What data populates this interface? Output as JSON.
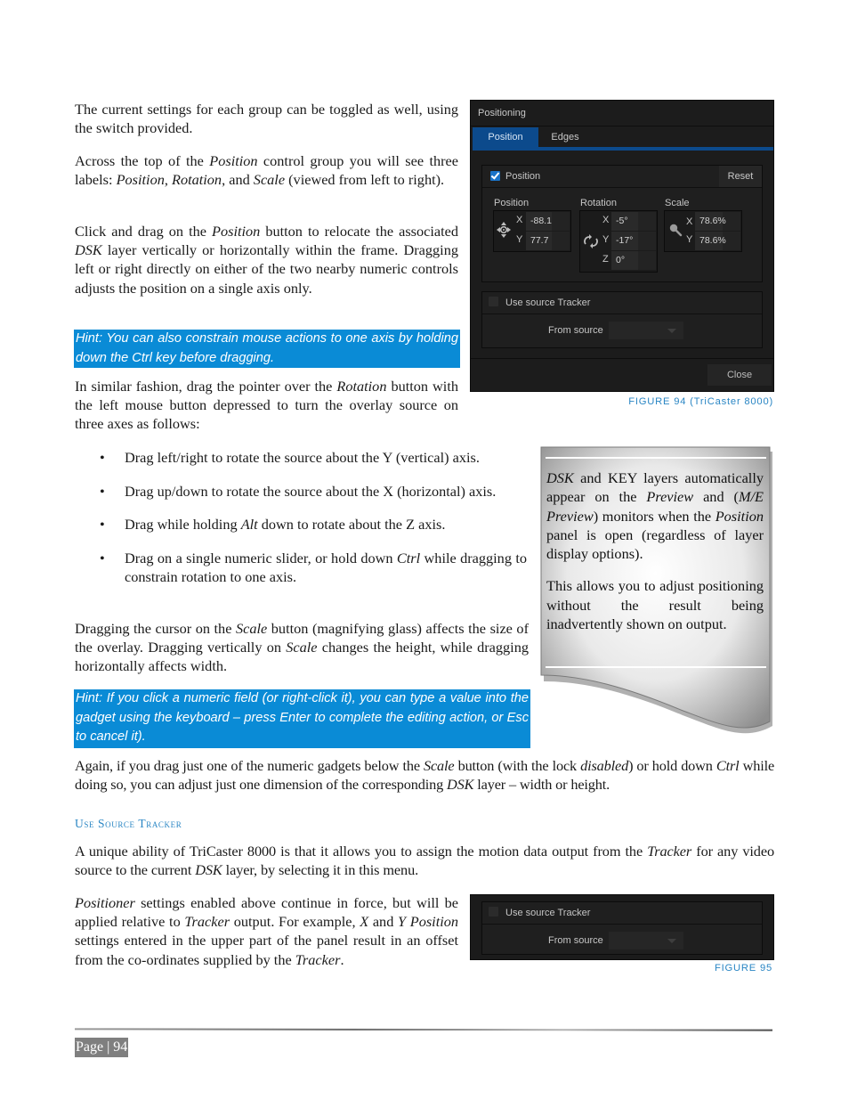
{
  "page": {
    "number_label": "Page | 94"
  },
  "paragraphs": {
    "p1": "The current settings for each group can be toggled as well, using the switch provided.",
    "p2_a": "Across the top of the ",
    "p2_b": "Position",
    "p2_c": " control group you will see three labels: ",
    "p2_d": "Position",
    "p2_e": ", ",
    "p2_f": "Rotation",
    "p2_g": ", and ",
    "p2_h": "Scale",
    "p2_i": " (viewed from left to right).",
    "p3_a": "Click and drag on the ",
    "p3_b": "Position",
    "p3_c": " button to relocate the associated ",
    "p3_d": "DSK",
    "p3_e": " layer vertically or horizontally within the frame.  Dragging left or right directly on either of the two nearby numeric controls adjusts the position on a single axis only.",
    "hint1": "Hint: You can also constrain mouse actions to one axis by holding down the Ctrl key before dragging.",
    "p4_a": "In similar fashion, drag the pointer over the ",
    "p4_b": "Rotation",
    "p4_c": " button with the left mouse button depressed to turn the overlay source on three axes as follows:",
    "bullets": [
      {
        "a": "Drag left/right to rotate the source about the Y (vertical) axis.",
        "b": "",
        "c": ""
      },
      {
        "a": "Drag up/down to rotate the source about the X (horizontal) axis.",
        "b": "",
        "c": ""
      },
      {
        "a": "Drag while holding ",
        "b": "Alt",
        "c": " down to rotate about the Z axis."
      },
      {
        "a": "Drag on a single numeric slider, or hold down ",
        "b": "Ctrl",
        "c": " while dragging to constrain rotation to one axis."
      }
    ],
    "bullet_glyph": "•",
    "p5_a": "Dragging the cursor on the ",
    "p5_b": "Scale",
    "p5_c": " button (magnifying glass) affects the size of the overlay.  Dragging vertically on ",
    "p5_d": "Scale",
    "p5_e": " changes the height, while dragging horizontally affects width.",
    "hint2": " Hint: If you click a numeric field (or right-click it), you can type a value into the gadget using the keyboard – press Enter to complete the editing action, or Esc to cancel it).",
    "p6_a": "Again, if you drag just one of the numeric gadgets below the ",
    "p6_b": "Scale",
    "p6_c": " button (with the lock ",
    "p6_d": "disabled",
    "p6_e": ") or hold down ",
    "p6_f": "Ctrl",
    "p6_g": " while doing so, you can adjust just one dimension of the corresponding ",
    "p6_h": "DSK",
    "p6_i": " layer – width or height.",
    "section_heading": "Use Source Tracker",
    "p7_a": "A unique ability of TriCaster 8000 is that it allows you to assign the motion data output from the ",
    "p7_b": "Tracker",
    "p7_c": " for any video source to the current ",
    "p7_d": "DSK",
    "p7_e": " layer, by selecting it in this menu.",
    "p8_a": "Positioner",
    "p8_b": " settings enabled above continue in force, but will be applied relative to ",
    "p8_c": "Tracker",
    "p8_d": " output.  For example, ",
    "p8_e": "X",
    "p8_f": " and ",
    "p8_g": "Y",
    "p8_h": " ",
    "p8_i": "Position",
    "p8_j": " settings entered in the upper part of the panel result in an offset from the co-ordinates supplied by the ",
    "p8_k": "Tracker",
    "p8_l": "."
  },
  "callout": {
    "p1_a": "DSK",
    "p1_b": " and KEY layers automatically appear on the ",
    "p1_c": "Preview",
    "p1_d": " and (",
    "p1_e": "M/E Preview",
    "p1_f": ") monitors when the ",
    "p1_g": "Position",
    "p1_h": " panel is open (regardless of layer display options).",
    "p2": "This allows you to adjust positioning without the result being inadvertently shown on output."
  },
  "figure94": {
    "caption": "FIGURE 94 (TriCaster 8000)",
    "window_title": "Positioning",
    "tabs": [
      {
        "label": "Position",
        "active": true
      },
      {
        "label": "Edges",
        "active": false
      }
    ],
    "position_group": {
      "enabled": true,
      "label": "Position",
      "reset_label": "Reset",
      "position": {
        "label": "Position",
        "icon": "move-icon",
        "x_label": "X",
        "x": "-88.1",
        "y_label": "Y",
        "y": "77.7"
      },
      "rotation": {
        "label": "Rotation",
        "icon": "rotate-icon",
        "x_label": "X",
        "x": "-5°",
        "y_label": "Y",
        "y": "-17°",
        "z_label": "Z",
        "z": "0°"
      },
      "scale": {
        "label": "Scale",
        "icon": "magnifier-icon",
        "x_label": "X",
        "x": "78.6%",
        "y_label": "Y",
        "y": "78.6%"
      }
    },
    "tracker": {
      "enabled": false,
      "label": "Use source Tracker",
      "from_source_label": "From source",
      "from_source_value": ""
    },
    "close_label": "Close"
  },
  "figure95": {
    "caption": "FIGURE 95",
    "tracker": {
      "enabled": false,
      "label": "Use source Tracker",
      "from_source_label": "From source",
      "from_source_value": ""
    }
  },
  "colors": {
    "hint_bg": "#0a8bd6",
    "accent_tab": "#0c4a8c",
    "caption": "#2a86c4",
    "page_label_bg": "#7f7f7f"
  }
}
